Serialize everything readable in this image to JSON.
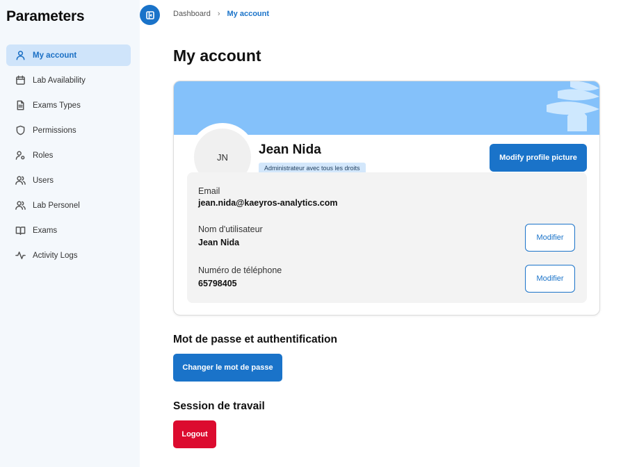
{
  "sidebar": {
    "title": "Parameters",
    "items": [
      {
        "label": "My account",
        "icon": "user-icon",
        "active": true
      },
      {
        "label": "Lab Availability",
        "icon": "calendar-icon"
      },
      {
        "label": "Exams Types",
        "icon": "document-icon"
      },
      {
        "label": "Permissions",
        "icon": "shield-icon"
      },
      {
        "label": "Roles",
        "icon": "user-cog-icon"
      },
      {
        "label": "Users",
        "icon": "users-icon"
      },
      {
        "label": "Lab Personel",
        "icon": "users-icon"
      },
      {
        "label": "Exams",
        "icon": "book-icon"
      },
      {
        "label": "Activity Logs",
        "icon": "activity-icon"
      }
    ]
  },
  "breadcrumb": {
    "parent": "Dashboard",
    "separator": "›",
    "current": "My account"
  },
  "page": {
    "title": "My account"
  },
  "profile": {
    "initials": "JN",
    "name": "Jean Nida",
    "role": "Administrateur avec tous les droits",
    "modify_picture_label": "Modify profile picture",
    "email_label": "Email",
    "email": "jean.nida@kaeyros-analytics.com",
    "username_label": "Nom d'utilisateur",
    "username": "Jean Nida",
    "phone_label": "Numéro de téléphone",
    "phone": "65798405",
    "modify_label": "Modifier"
  },
  "security": {
    "title": "Mot de passe et authentification",
    "change_password_label": "Changer le mot de passe"
  },
  "session": {
    "title": "Session de travail",
    "logout_label": "Logout"
  },
  "colors": {
    "primary": "#1a73c9",
    "danger": "#dc0b2f",
    "banner": "#84c1fa",
    "sidebar_bg": "#f4f8fc",
    "active_bg": "#cfe4fa"
  }
}
